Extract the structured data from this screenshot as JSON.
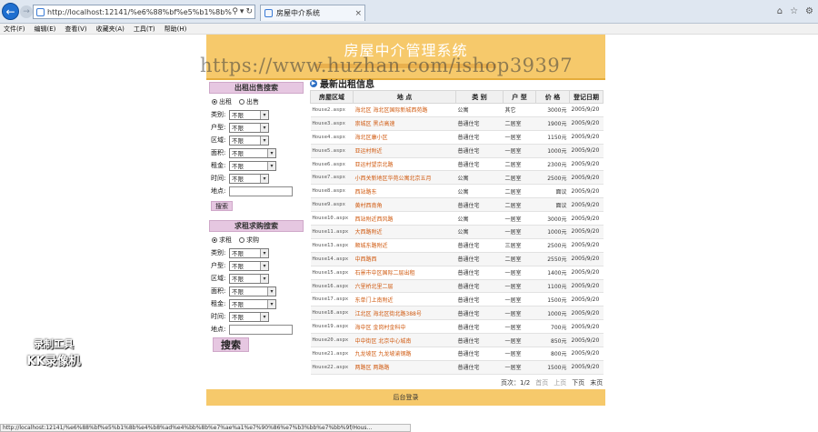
{
  "browser": {
    "url": "http://localhost:12141/%e6%88%bf%e5%b1%8b%e4%b8%ad",
    "tab_title": "房屋中介系统",
    "status_url": "http://localhost:12141/%e6%88%bf%e5%b1%8b%e4%b8%ad%e4%bb%8b%e7%ae%a1%e7%90%86%e7%b3%bb%e7%bb%9f/Hous..."
  },
  "menu": [
    "文件(F)",
    "编辑(E)",
    "查看(V)",
    "收藏夹(A)",
    "工具(T)",
    "帮助(H)"
  ],
  "site": {
    "title": "房屋中介管理系统",
    "watermark": "https://www.huzhan.com/ishop39397",
    "footer": "后台登录"
  },
  "rent_search": {
    "title": "出租出售搜索",
    "radio1": "出租",
    "radio2": "出售",
    "labels": [
      "类别:",
      "户型:",
      "区域:",
      "面积:",
      "租金:",
      "时间:",
      "地点:"
    ],
    "select_value": "不限",
    "button": "搜索"
  },
  "want_search": {
    "title": "求租求购搜索",
    "radio1": "求租",
    "radio2": "求购",
    "labels": [
      "类别:",
      "户型:",
      "区域:",
      "面积:",
      "租金:",
      "时间:",
      "地点:"
    ],
    "select_value": "不限",
    "button": "搜索"
  },
  "listing": {
    "title": "最新出租信息",
    "headers": [
      "房屋区域",
      "地 点",
      "类 别",
      "户 型",
      "价 格",
      "登记日期"
    ],
    "rows": [
      [
        "House2.aspx",
        "海北区 海北区国际新城西苑路",
        "公寓",
        "其它",
        "3000元",
        "2005/9/20"
      ],
      [
        "House3.aspx",
        "崇城区 黑点高速",
        "普通住宅",
        "二居室",
        "1900元",
        "2005/9/20"
      ],
      [
        "House4.aspx",
        "海北区康小区",
        "普通住宅",
        "一居室",
        "1150元",
        "2005/9/20"
      ],
      [
        "House5.aspx",
        "亚运村附近",
        "普通住宅",
        "一居室",
        "1000元",
        "2005/9/20"
      ],
      [
        "House6.aspx",
        "亚运村望京北路",
        "普通住宅",
        "二居室",
        "2300元",
        "2005/9/20"
      ],
      [
        "House7.aspx",
        "小西关新地区华苑公寓北京五月",
        "公寓",
        "二居室",
        "2500元",
        "2005/9/20"
      ],
      [
        "House8.aspx",
        "西站路东",
        "公寓",
        "二居室",
        "面议",
        "2005/9/20"
      ],
      [
        "House9.aspx",
        "黄村西南角",
        "普通住宅",
        "二居室",
        "面议",
        "2005/9/20"
      ],
      [
        "House10.aspx",
        "西站附近西风路",
        "公寓",
        "一居室",
        "3000元",
        "2005/9/20"
      ],
      [
        "House11.aspx",
        "大西路附近",
        "公寓",
        "一居室",
        "1000元",
        "2005/9/20"
      ],
      [
        "House13.aspx",
        "顺城东路附近",
        "普通住宅",
        "三居室",
        "2500元",
        "2005/9/20"
      ],
      [
        "House14.aspx",
        "中西路西",
        "普通住宅",
        "二居室",
        "2550元",
        "2005/9/20"
      ],
      [
        "House15.aspx",
        "石景市中区国际二层出租",
        "普通住宅",
        "一居室",
        "1400元",
        "2005/9/20"
      ],
      [
        "House16.aspx",
        "六里桥北里二层",
        "普通住宅",
        "一居室",
        "1100元",
        "2005/9/20"
      ],
      [
        "House17.aspx",
        "东单门上南附近",
        "普通住宅",
        "一居室",
        "1500元",
        "2005/9/20"
      ],
      [
        "House18.aspx",
        "江北区 海北区街北路388号",
        "普通住宅",
        "一居室",
        "1000元",
        "2005/9/20"
      ],
      [
        "House19.aspx",
        "海中区 金岗村金科中",
        "普通住宅",
        "一居室",
        "700元",
        "2005/9/20"
      ],
      [
        "House20.aspx",
        "中中街区 北京中心城南",
        "普通住宅",
        "一居室",
        "850元",
        "2005/9/20"
      ],
      [
        "House21.aspx",
        "九龙坡区 九龙坡渝钢路",
        "普通住宅",
        "一居室",
        "800元",
        "2005/9/20"
      ],
      [
        "House22.aspx",
        "两路区 两路路",
        "普通住宅",
        "一居室",
        "1500元",
        "2005/9/20"
      ]
    ]
  },
  "pager": {
    "pages": "页次：1/2",
    "first": "首页",
    "prev": "上页",
    "next": "下页",
    "last": "末页"
  },
  "recorder": {
    "line1": "录制工具",
    "line2": "KK录像机"
  }
}
